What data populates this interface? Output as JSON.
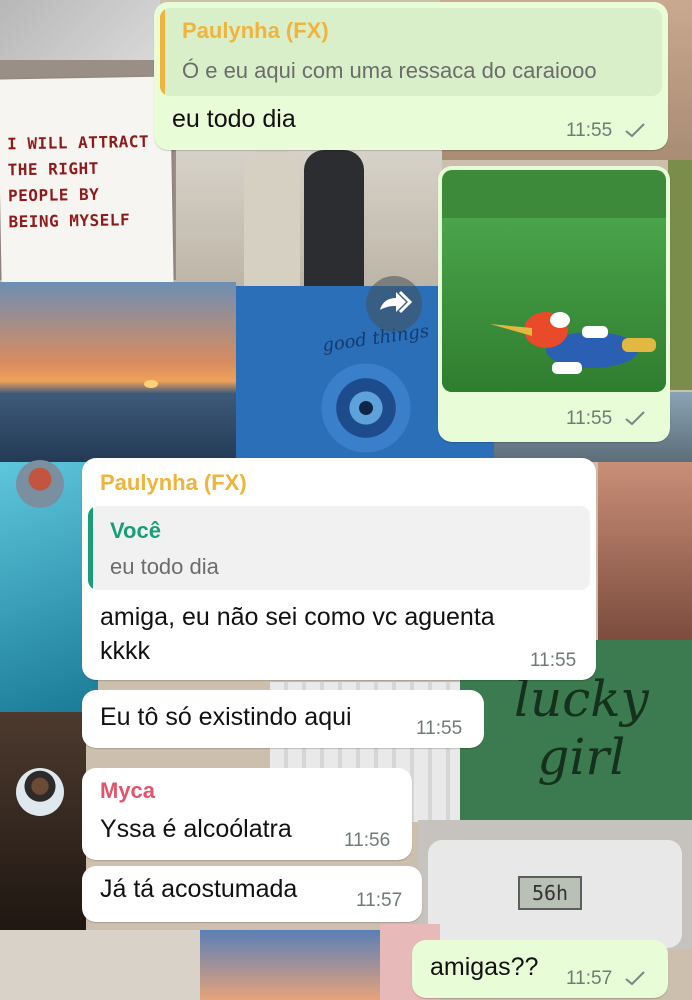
{
  "messages": [
    {
      "quote_name": "Paulynha (FX)",
      "quote_text": "Ó e eu aqui com uma ressaca do caraiooo",
      "text": "eu todo dia",
      "time": "11:55"
    },
    {
      "time": "11:55"
    },
    {
      "sender": "Paulynha (FX)",
      "quote_name": "Você",
      "quote_text": "eu todo dia",
      "text_line1": "amiga, eu não sei como vc aguenta",
      "text_line2": "kkkk",
      "time": "11:55"
    },
    {
      "text": "Eu tô só existindo aqui",
      "time": "11:55"
    },
    {
      "sender": "Myca",
      "text": "Yssa é alcoólatra",
      "time": "11:56"
    },
    {
      "text": "Já tá acostumada",
      "time": "11:57"
    },
    {
      "text": "amigas??",
      "time": "11:57"
    }
  ],
  "wallpaper": {
    "note_lines": [
      "I WILL ATTRACT",
      "THE RIGHT",
      "PEOPLE BY",
      "BEING MYSELF"
    ],
    "good_things": "good things",
    "lucky_line1": "lucky",
    "lucky_line2": "girl",
    "scale_reading": "56h"
  },
  "colors": {
    "outgoing_bubble": "#e7fcd7",
    "incoming_bubble": "#ffffff",
    "paulynha_name": "#f0b43c",
    "voce_name": "#1a9e7a",
    "myca_name": "#e0566c",
    "quote_bg_out": "#d9efc9",
    "quote_bg_in": "#f1f1f1"
  },
  "icons": [
    "check-icon",
    "forward-icon",
    "avatar-paulynha",
    "avatar-myca"
  ]
}
